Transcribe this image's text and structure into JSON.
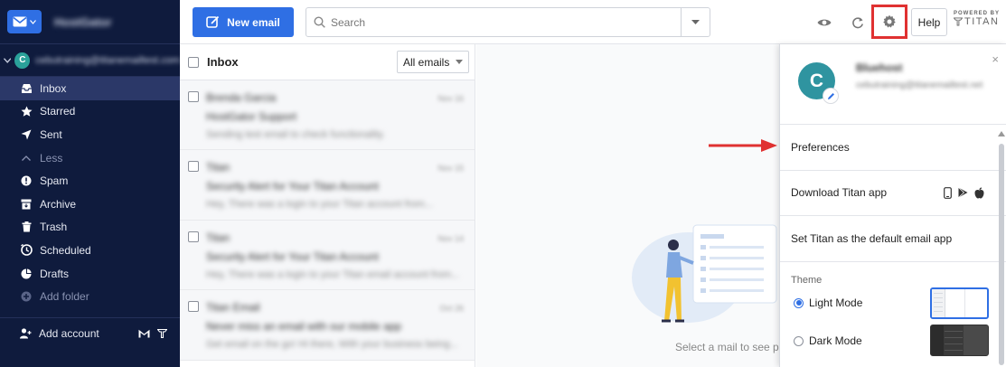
{
  "sidebar": {
    "brand": "HostGator",
    "account_initial": "C",
    "account_email": "cebutraining@titanemailtest.com",
    "items": [
      {
        "label": "Inbox",
        "icon": "inbox-icon",
        "active": true
      },
      {
        "label": "Starred",
        "icon": "star-icon"
      },
      {
        "label": "Sent",
        "icon": "send-icon"
      },
      {
        "label": "Less",
        "icon": "chevron-up-icon",
        "muted": true
      },
      {
        "label": "Spam",
        "icon": "spam-icon"
      },
      {
        "label": "Archive",
        "icon": "archive-icon"
      },
      {
        "label": "Trash",
        "icon": "trash-icon"
      },
      {
        "label": "Scheduled",
        "icon": "clock-icon"
      },
      {
        "label": "Drafts",
        "icon": "drafts-icon"
      },
      {
        "label": "Add folder",
        "icon": "add-folder-icon",
        "muted": true
      }
    ],
    "add_account": "Add account"
  },
  "toolbar": {
    "new_email": "New email",
    "search_placeholder": "Search",
    "help": "Help",
    "powered_by": "POWERED BY",
    "titan": "TITAN"
  },
  "list": {
    "title": "Inbox",
    "filter": "All emails",
    "emails": [
      {
        "from": "Brenda Garcia",
        "date": "Nov 16",
        "subject": "HostGator Support",
        "preview": "Sending test email to check functionality."
      },
      {
        "from": "Titan",
        "date": "Nov 15",
        "subject": "Security Alert for Your Titan Account",
        "preview": "Hey, There was a login to your Titan account from..."
      },
      {
        "from": "Titan",
        "date": "Nov 14",
        "subject": "Security Alert for Your Titan Account",
        "preview": "Hey, There was a login to your Titan email account from..."
      },
      {
        "from": "Titan Email",
        "date": "Oct 26",
        "subject": "Never miss an email with our mobile app",
        "preview": "Get email on the go! Hi there, With your business being..."
      }
    ]
  },
  "reading": {
    "empty_message": "Select a mail to see p"
  },
  "panel": {
    "initial": "C",
    "name": "Bluehost",
    "email": "cebutraining@titanemailtest.net",
    "close": "×",
    "preferences": "Preferences",
    "download": "Download Titan app",
    "default_app": "Set Titan as the default email app",
    "theme_label": "Theme",
    "light": "Light Mode",
    "dark": "Dark Mode"
  },
  "colors": {
    "sidebar_bg": "#0f1b3d",
    "accent": "#2f6fe4",
    "highlight": "#e03131"
  }
}
